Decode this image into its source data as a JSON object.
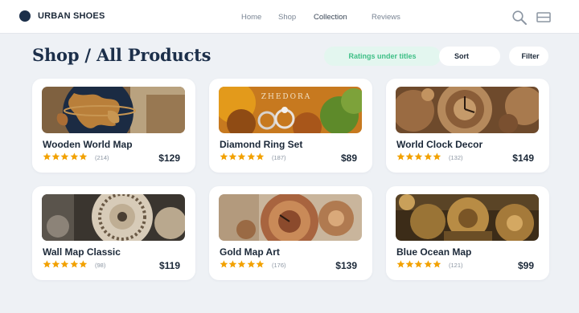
{
  "brand": {
    "name": "URBAN SHOES",
    "accent": "#1c2f4a"
  },
  "nav": [
    {
      "label": "Home"
    },
    {
      "label": "Shop"
    },
    {
      "label": "Collection"
    },
    {
      "label": "Reviews"
    }
  ],
  "header_icons": [
    "search-icon",
    "menu-icon"
  ],
  "page": {
    "title": "Shop / All Products",
    "ratings_toggle": "Ratings under titles",
    "sort_label": "Sort",
    "filter_label": "Filter"
  },
  "colors": {
    "star": "#f2a100",
    "ratings_pill_bg": "#e3f6ef",
    "ratings_pill_text": "#3ebf86",
    "background": "#eef1f5"
  },
  "products": [
    {
      "name": "Wooden World Map",
      "price": "$129",
      "reviews": "(214)",
      "stars": 5,
      "image_text": ""
    },
    {
      "name": "Diamond Ring Set",
      "price": "$89",
      "reviews": "(187)",
      "stars": 5,
      "image_text": "ZHEDORA"
    },
    {
      "name": "World Clock Decor",
      "price": "$149",
      "reviews": "(132)",
      "stars": 5,
      "image_text": ""
    },
    {
      "name": "Wall Map Classic",
      "price": "$119",
      "reviews": "(98)",
      "stars": 5,
      "image_text": ""
    },
    {
      "name": "Gold Map Art",
      "price": "$139",
      "reviews": "(176)",
      "stars": 5,
      "image_text": ""
    },
    {
      "name": "Blue Ocean Map",
      "price": "$99",
      "reviews": "(121)",
      "stars": 5,
      "image_text": ""
    }
  ]
}
